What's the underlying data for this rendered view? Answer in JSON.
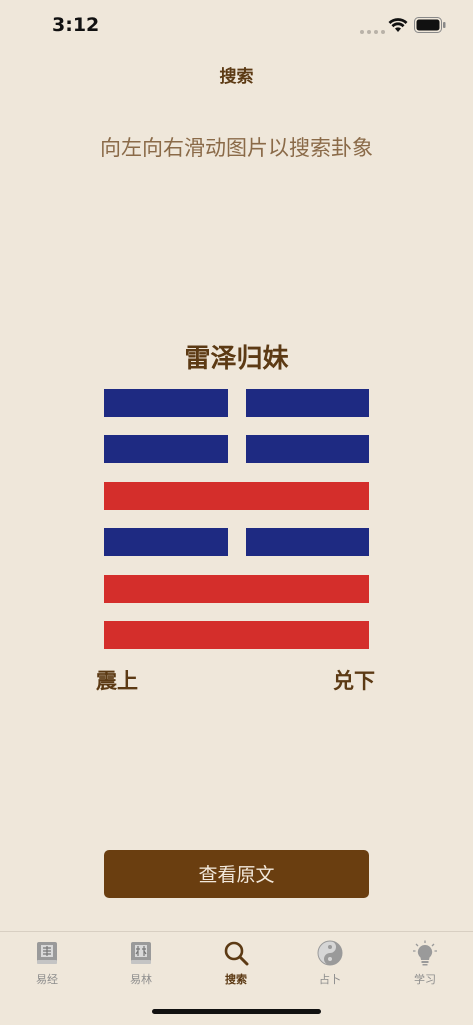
{
  "status_bar": {
    "time": "3:12"
  },
  "nav": {
    "title": "搜索"
  },
  "instruction": "向左向右滑动图片以搜索卦象",
  "hexagram": {
    "name": "雷泽归妹",
    "lines_top_to_bottom": [
      "yin",
      "yin",
      "yang",
      "yin",
      "yang",
      "yang"
    ],
    "upper_trigram": "震上",
    "lower_trigram": "兑下",
    "colors": {
      "yin": "#1e2a82",
      "yang": "#d42e2b"
    }
  },
  "button": {
    "label": "查看原文"
  },
  "tabs": [
    {
      "label": "易经",
      "icon": "book-jing-icon",
      "active": false
    },
    {
      "label": "易林",
      "icon": "book-lin-icon",
      "active": false
    },
    {
      "label": "搜索",
      "icon": "search-icon",
      "active": true
    },
    {
      "label": "占卜",
      "icon": "yin-yang-icon",
      "active": false
    },
    {
      "label": "学习",
      "icon": "lightbulb-icon",
      "active": false
    }
  ],
  "colors": {
    "accent": "#6a3e10",
    "title_text": "#5c3a14",
    "instruction_text": "#8a6a48",
    "background": "#efe7da"
  }
}
